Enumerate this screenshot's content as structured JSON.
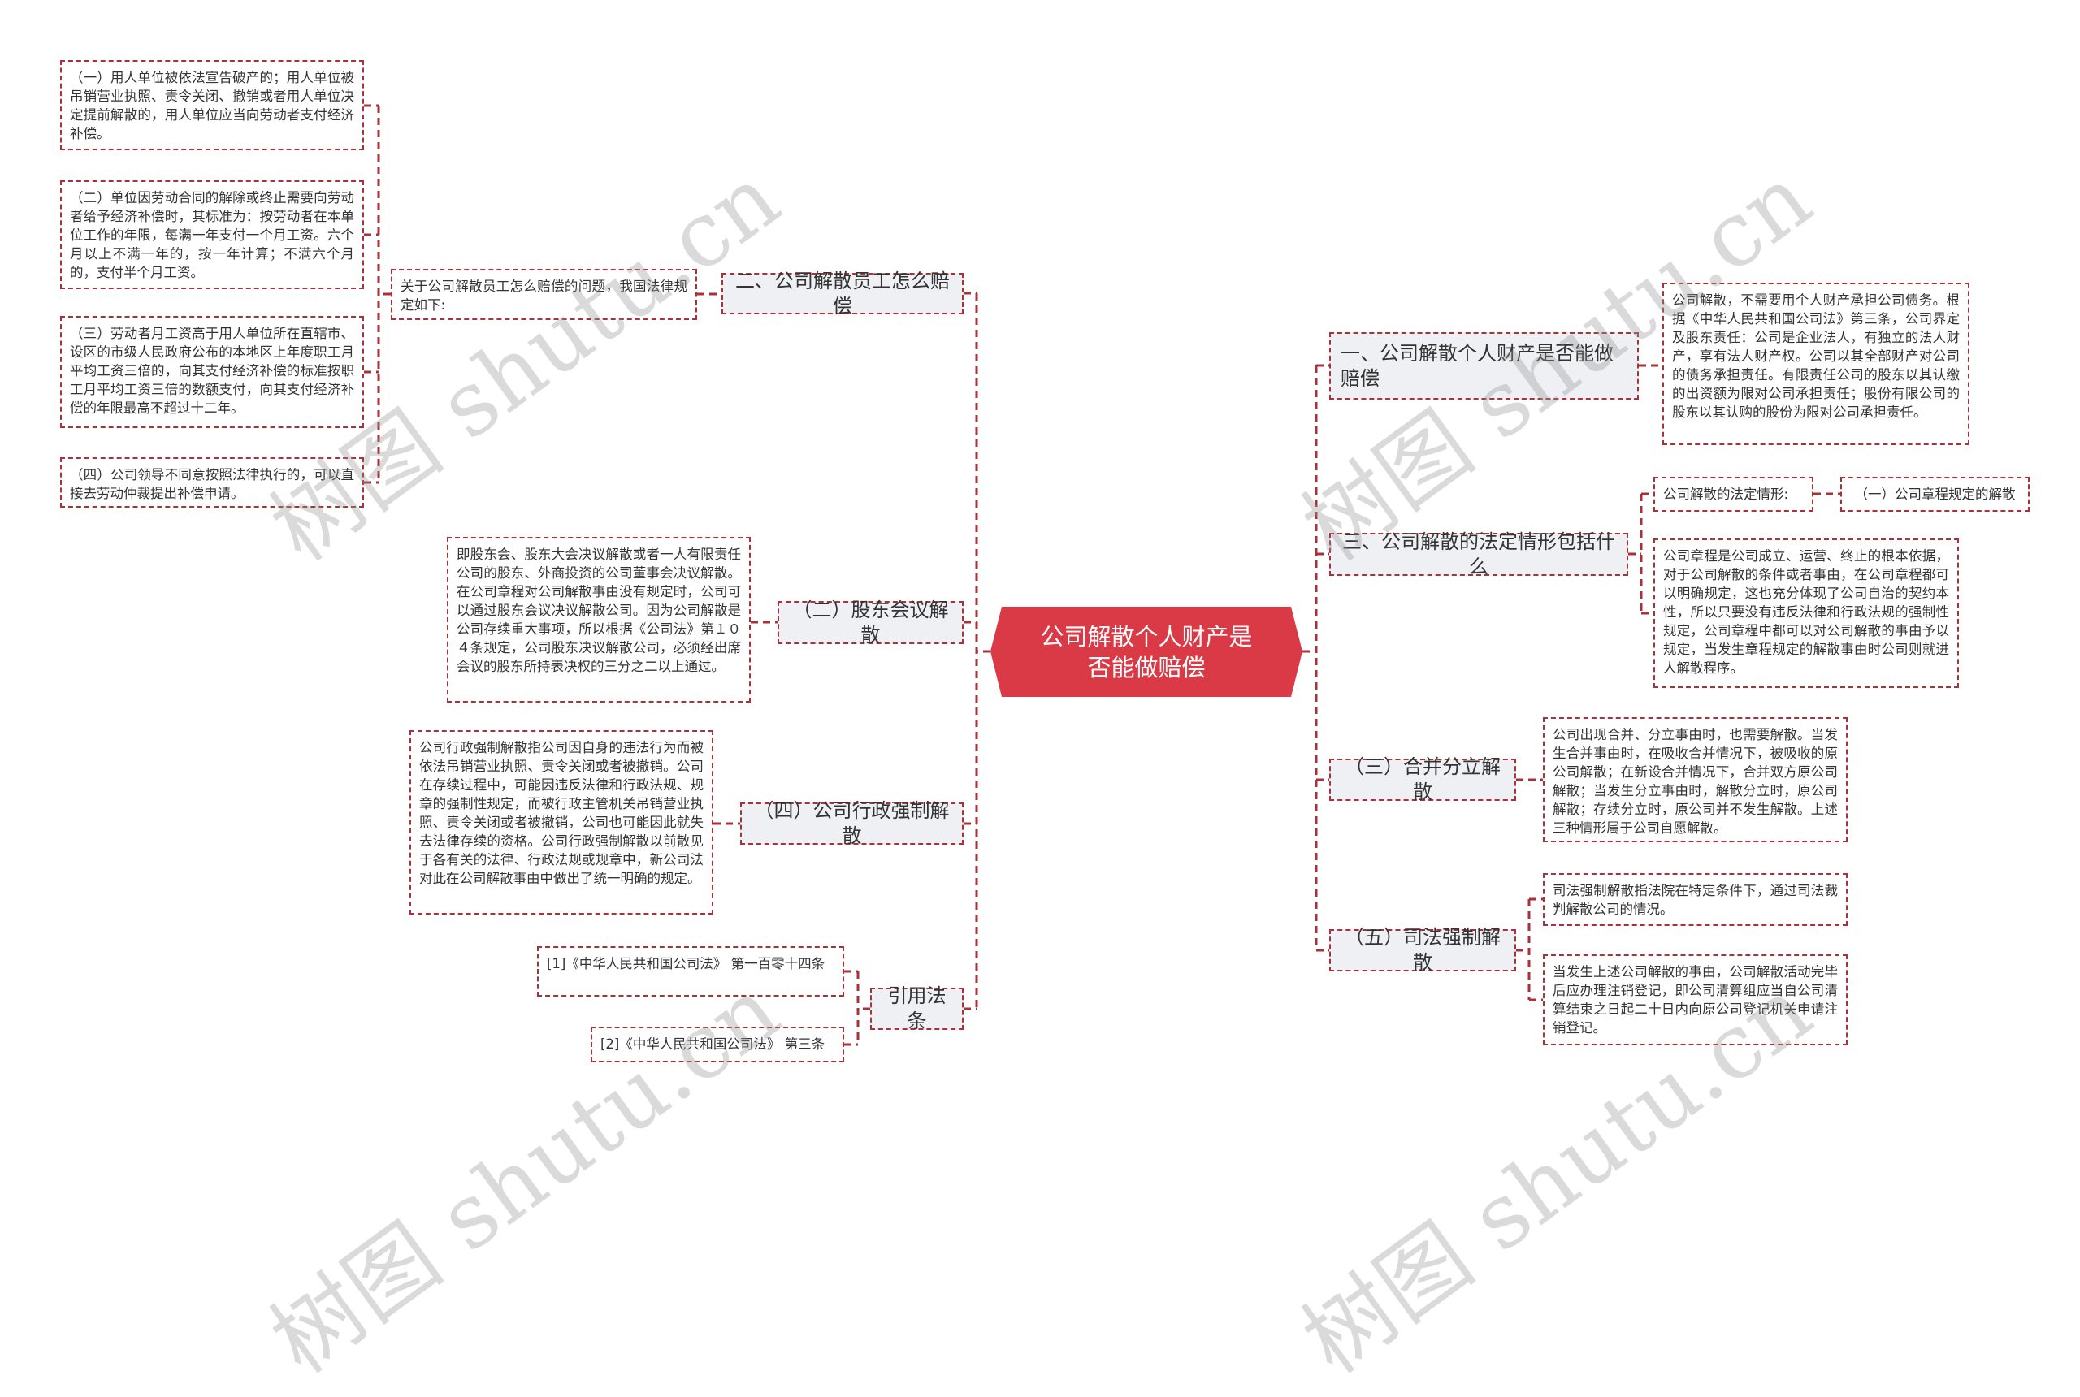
{
  "root": {
    "title": "公司解散个人财产是否能做赔偿"
  },
  "colors": {
    "accent": "#d93a45",
    "border": "#a8323a",
    "topic_bg": "#eef0f3"
  },
  "left": {
    "compensation": {
      "label": "二、公司解散员工怎么赔偿",
      "intro": "关于公司解散员工怎么赔偿的问题，我国法律规定如下:",
      "items": [
        "（一）用人单位被依法宣告破产的；用人单位被吊销营业执照、责令关闭、撤销或者用人单位决定提前解散的，用人单位应当向劳动者支付经济补偿。",
        "（二）单位因劳动合同的解除或终止需要向劳动者给予经济补偿时，其标准为：按劳动者在本单位工作的年限，每满一年支付一个月工资。六个月以上不满一年的，按一年计算；不满六个月的，支付半个月工资。",
        "（三）劳动者月工资高于用人单位所在直辖市、设区的市级人民政府公布的本地区上年度职工月平均工资三倍的，向其支付经济补偿的标准按职工月平均工资三倍的数额支付，向其支付经济补偿的年限最高不超过十二年。",
        "（四）公司领导不同意按照法律执行的，可以直接去劳动仲裁提出补偿申请。"
      ]
    },
    "shareholder": {
      "label": "（二）股东会议解散",
      "detail": "即股东会、股东大会决议解散或者一人有限责任公司的股东、外商投资的公司董事会决议解散。在公司章程对公司解散事由没有规定时，公司可以通过股东会议决议解散公司。因为公司解散是公司存续重大事项，所以根据《公司法》第１０４条规定，公司股东决议解散公司，必须经出席会议的股东所持表决权的三分之二以上通过。"
    },
    "administrative": {
      "label": "（四）公司行政强制解散",
      "detail": "公司行政强制解散指公司因自身的违法行为而被依法吊销营业执照、责令关闭或者被撤销。公司在存续过程中，可能因违反法律和行政法规、规章的强制性规定，而被行政主管机关吊销营业执照、责令关闭或者被撤销，公司也可能因此就失去法律存续的资格。公司行政强制解散以前散见于各有关的法律、行政法规或规章中，新公司法对此在公司解散事由中做出了统一明确的规定。"
    },
    "citations": {
      "label": "引用法条",
      "items": [
        "[1]《中华人民共和国公司法》 第一百零十四条",
        "[2]《中华人民共和国公司法》 第三条"
      ]
    }
  },
  "right": {
    "personal_property": {
      "label": "一、公司解散个人财产是否能做赔偿",
      "detail": "公司解散，不需要用个人财产承担公司债务。根据《中华人民共和国公司法》第三条，公司界定及股东责任：公司是企业法人，有独立的法人财产，享有法人财产权。公司以其全部财产对公司的债务承担责任。有限责任公司的股东以其认缴的出资额为限对公司承担责任；股份有限公司的股东以其认购的股份为限对公司承担责任。"
    },
    "statutory": {
      "label": "三、公司解散的法定情形包括什么",
      "sub_label": "公司解散的法定情形:",
      "sub_child": "（一）公司章程规定的解散",
      "detail": "公司章程是公司成立、运营、终止的根本依据，对于公司解散的条件或者事由，在公司章程都可以明确规定，这也充分体现了公司自治的契约本性，所以只要没有违反法律和行政法规的强制性规定，公司章程中都可以对公司解散的事由予以规定，当发生章程规定的解散事由时公司则就进人解散程序。"
    },
    "merger": {
      "label": "（三）合并分立解散",
      "detail": "公司出现合并、分立事由时，也需要解散。当发生合并事由时，在吸收合并情况下，被吸收的原公司解散；在新设合并情况下，合并双方原公司解散；当发生分立事由时，解散分立时，原公司解散；存续分立时，原公司并不发生解散。上述三种情形属于公司自愿解散。"
    },
    "judicial": {
      "label": "（五）司法强制解散",
      "details": [
        "司法强制解散指法院在特定条件下，通过司法裁判解散公司的情况。",
        "当发生上述公司解散的事由，公司解散活动完毕后应办理注销登记，即公司清算组应当自公司清算结束之日起二十日内向原公司登记机关申请注销登记。"
      ]
    }
  },
  "watermark": {
    "text": "树图 shutu.cn"
  }
}
